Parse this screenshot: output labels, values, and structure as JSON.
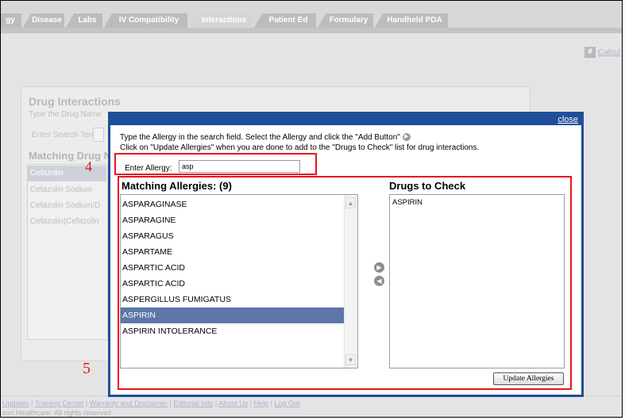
{
  "tabs": [
    {
      "label": "gy"
    },
    {
      "label": "Disease"
    },
    {
      "label": "Labs"
    },
    {
      "label": "IV Compatibility"
    },
    {
      "label": "Interactions"
    },
    {
      "label": "Patient Ed"
    },
    {
      "label": "Formulary"
    },
    {
      "label": "Handheld PDA"
    }
  ],
  "calc_link": "Calcul",
  "background": {
    "title": "Drug Interactions",
    "subtitle": "Type the Drug Name",
    "search_label": "Enter Search Term:",
    "matching_heading": "Matching Drug N",
    "items": [
      "Cefazolin",
      "Cefazolin Sodium",
      "Cefazolin Sodium/D",
      "Cefazolin(Cefazolin"
    ]
  },
  "footer": {
    "links": [
      "Updates",
      "Training Center",
      "Warranty and Disclaimer",
      "Editorial Info",
      "About Us",
      "Help",
      "Log Out"
    ],
    "copyright": "son Healthcare. All rights reserved."
  },
  "modal": {
    "close": "close",
    "instruction1": "Type the Allergy in the search field. Select the Allergy and click the \"Add Button\"",
    "instruction2": "Click on \"Update Allergies\" when you are done to add to the \"Drugs to Check\" list for drug interactions.",
    "allergy_label": "Enter Allergy:",
    "allergy_value": "asp",
    "matching_heading": "Matching Allergies: (9)",
    "allergies": [
      "ASPARAGINASE",
      "ASPARAGINE",
      "ASPARAGUS",
      "ASPARTAME",
      "ASPARTIC ACID",
      "ASPARTIC ACID",
      "ASPERGILLUS FUMIGATUS",
      "ASPIRIN",
      "ASPIRIN INTOLERANCE"
    ],
    "selected_index": 7,
    "drugs_heading": "Drugs to Check",
    "drugs": [
      "ASPIRIN"
    ],
    "update_button": "Update Allergies"
  },
  "annotations": {
    "label_4": "4",
    "label_5": "5"
  },
  "colors": {
    "modal_border": "#1f4f9a",
    "selected_row": "#5d76a7",
    "highlight": "#e8141c"
  }
}
